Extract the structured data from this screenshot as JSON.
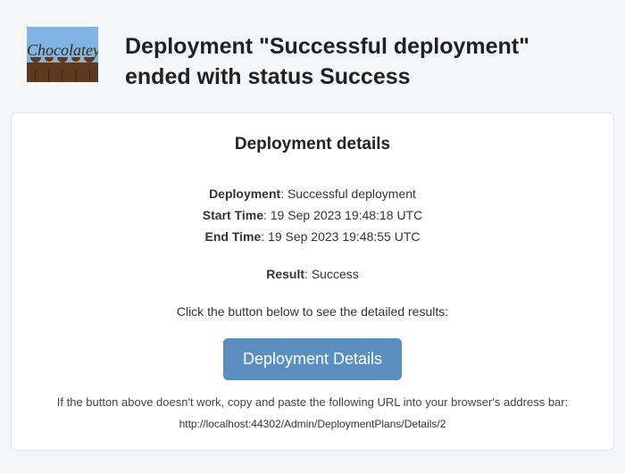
{
  "header": {
    "logo_text": "Chocolatey",
    "title": "Deployment \"Successful deployment\" ended with status Success"
  },
  "card": {
    "heading": "Deployment details",
    "details": {
      "deployment_label": "Deployment",
      "deployment_value": "Successful deployment",
      "start_label": "Start Time",
      "start_value": "19 Sep 2023 19:48:18 UTC",
      "end_label": "End Time",
      "end_value": "19 Sep 2023 19:48:55 UTC",
      "result_label": "Result",
      "result_value": "Success"
    },
    "cta_instruction": "Click the button below to see the detailed results:",
    "button_label": "Deployment Details",
    "fallback_text": "If the button above doesn't work, copy and paste the following URL into your browser's address bar:",
    "url": "http://localhost:44302/Admin/DeploymentPlans/Details/2"
  }
}
